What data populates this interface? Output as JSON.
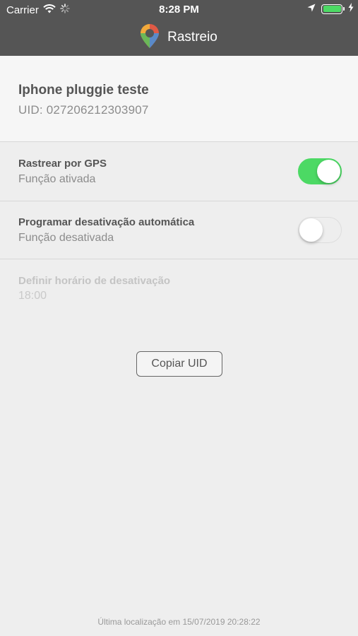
{
  "status_bar": {
    "carrier": "Carrier",
    "time": "8:28 PM",
    "battery_color": "#4cd964"
  },
  "nav": {
    "title": "Rastreio",
    "logo_icon": "map-pin-logo-icon"
  },
  "device": {
    "name": "Iphone pluggie teste",
    "uid": "UID: 027206212303907"
  },
  "settings": {
    "gps": {
      "title": "Rastrear por GPS",
      "subtitle": "Função ativada",
      "enabled": true
    },
    "auto_disable": {
      "title": "Programar desativação automática",
      "subtitle": "Função desativada",
      "enabled": false
    },
    "disable_time": {
      "title": "Definir horário de desativação",
      "value": "18:00"
    }
  },
  "actions": {
    "copy_uid_label": "Copiar UID"
  },
  "footer": {
    "last_location": "Última localização em 15/07/2019 20:28:22"
  },
  "colors": {
    "topbar": "#555555",
    "switch_on": "#4cd964",
    "background": "#eeeeee"
  }
}
